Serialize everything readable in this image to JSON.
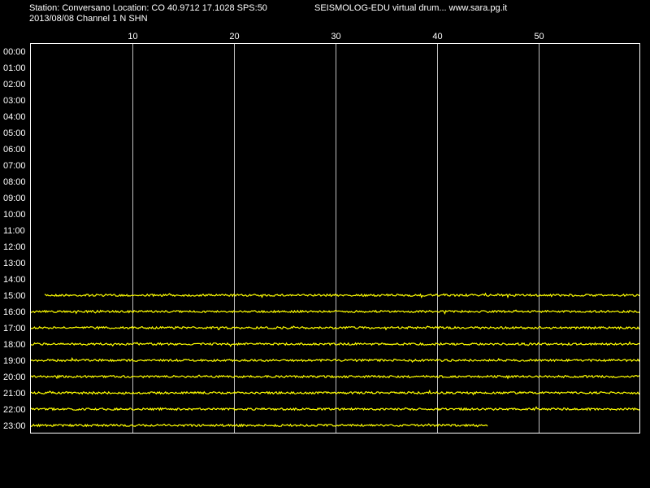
{
  "header": {
    "station_line": "Station: Conversano Location: CO 40.9712 17.1028 SPS:50",
    "program_line": "SEISMOLOG-EDU virtual drum... www.sara.pg.it",
    "date_channel_line": "2013/08/08  Channel 1 N SHN"
  },
  "colors": {
    "background": "#000000",
    "text": "#ffffff",
    "frame": "#ffffff",
    "grid": "#c0c0c0",
    "trace": "#ffff00"
  },
  "chart_data": {
    "type": "line",
    "title": "",
    "x_ticks": [
      10,
      20,
      30,
      40,
      50
    ],
    "xlim": [
      0,
      60
    ],
    "grid": true,
    "rows": [
      "00:00",
      "01:00",
      "02:00",
      "03:00",
      "04:00",
      "05:00",
      "06:00",
      "07:00",
      "08:00",
      "09:00",
      "10:00",
      "11:00",
      "12:00",
      "13:00",
      "14:00",
      "15:00",
      "16:00",
      "17:00",
      "18:00",
      "19:00",
      "20:00",
      "21:00",
      "22:00",
      "23:00"
    ],
    "traces": [
      {
        "row": "15:00",
        "x_start": 1.4,
        "x_end": 60
      },
      {
        "row": "16:00",
        "x_start": 0,
        "x_end": 60
      },
      {
        "row": "17:00",
        "x_start": 0,
        "x_end": 60
      },
      {
        "row": "18:00",
        "x_start": 0,
        "x_end": 60
      },
      {
        "row": "19:00",
        "x_start": 0,
        "x_end": 60
      },
      {
        "row": "20:00",
        "x_start": 0,
        "x_end": 60
      },
      {
        "row": "21:00",
        "x_start": 0,
        "x_end": 60
      },
      {
        "row": "22:00",
        "x_start": 0,
        "x_end": 60
      },
      {
        "row": "23:00",
        "x_start": 0,
        "x_end": 45
      }
    ]
  }
}
